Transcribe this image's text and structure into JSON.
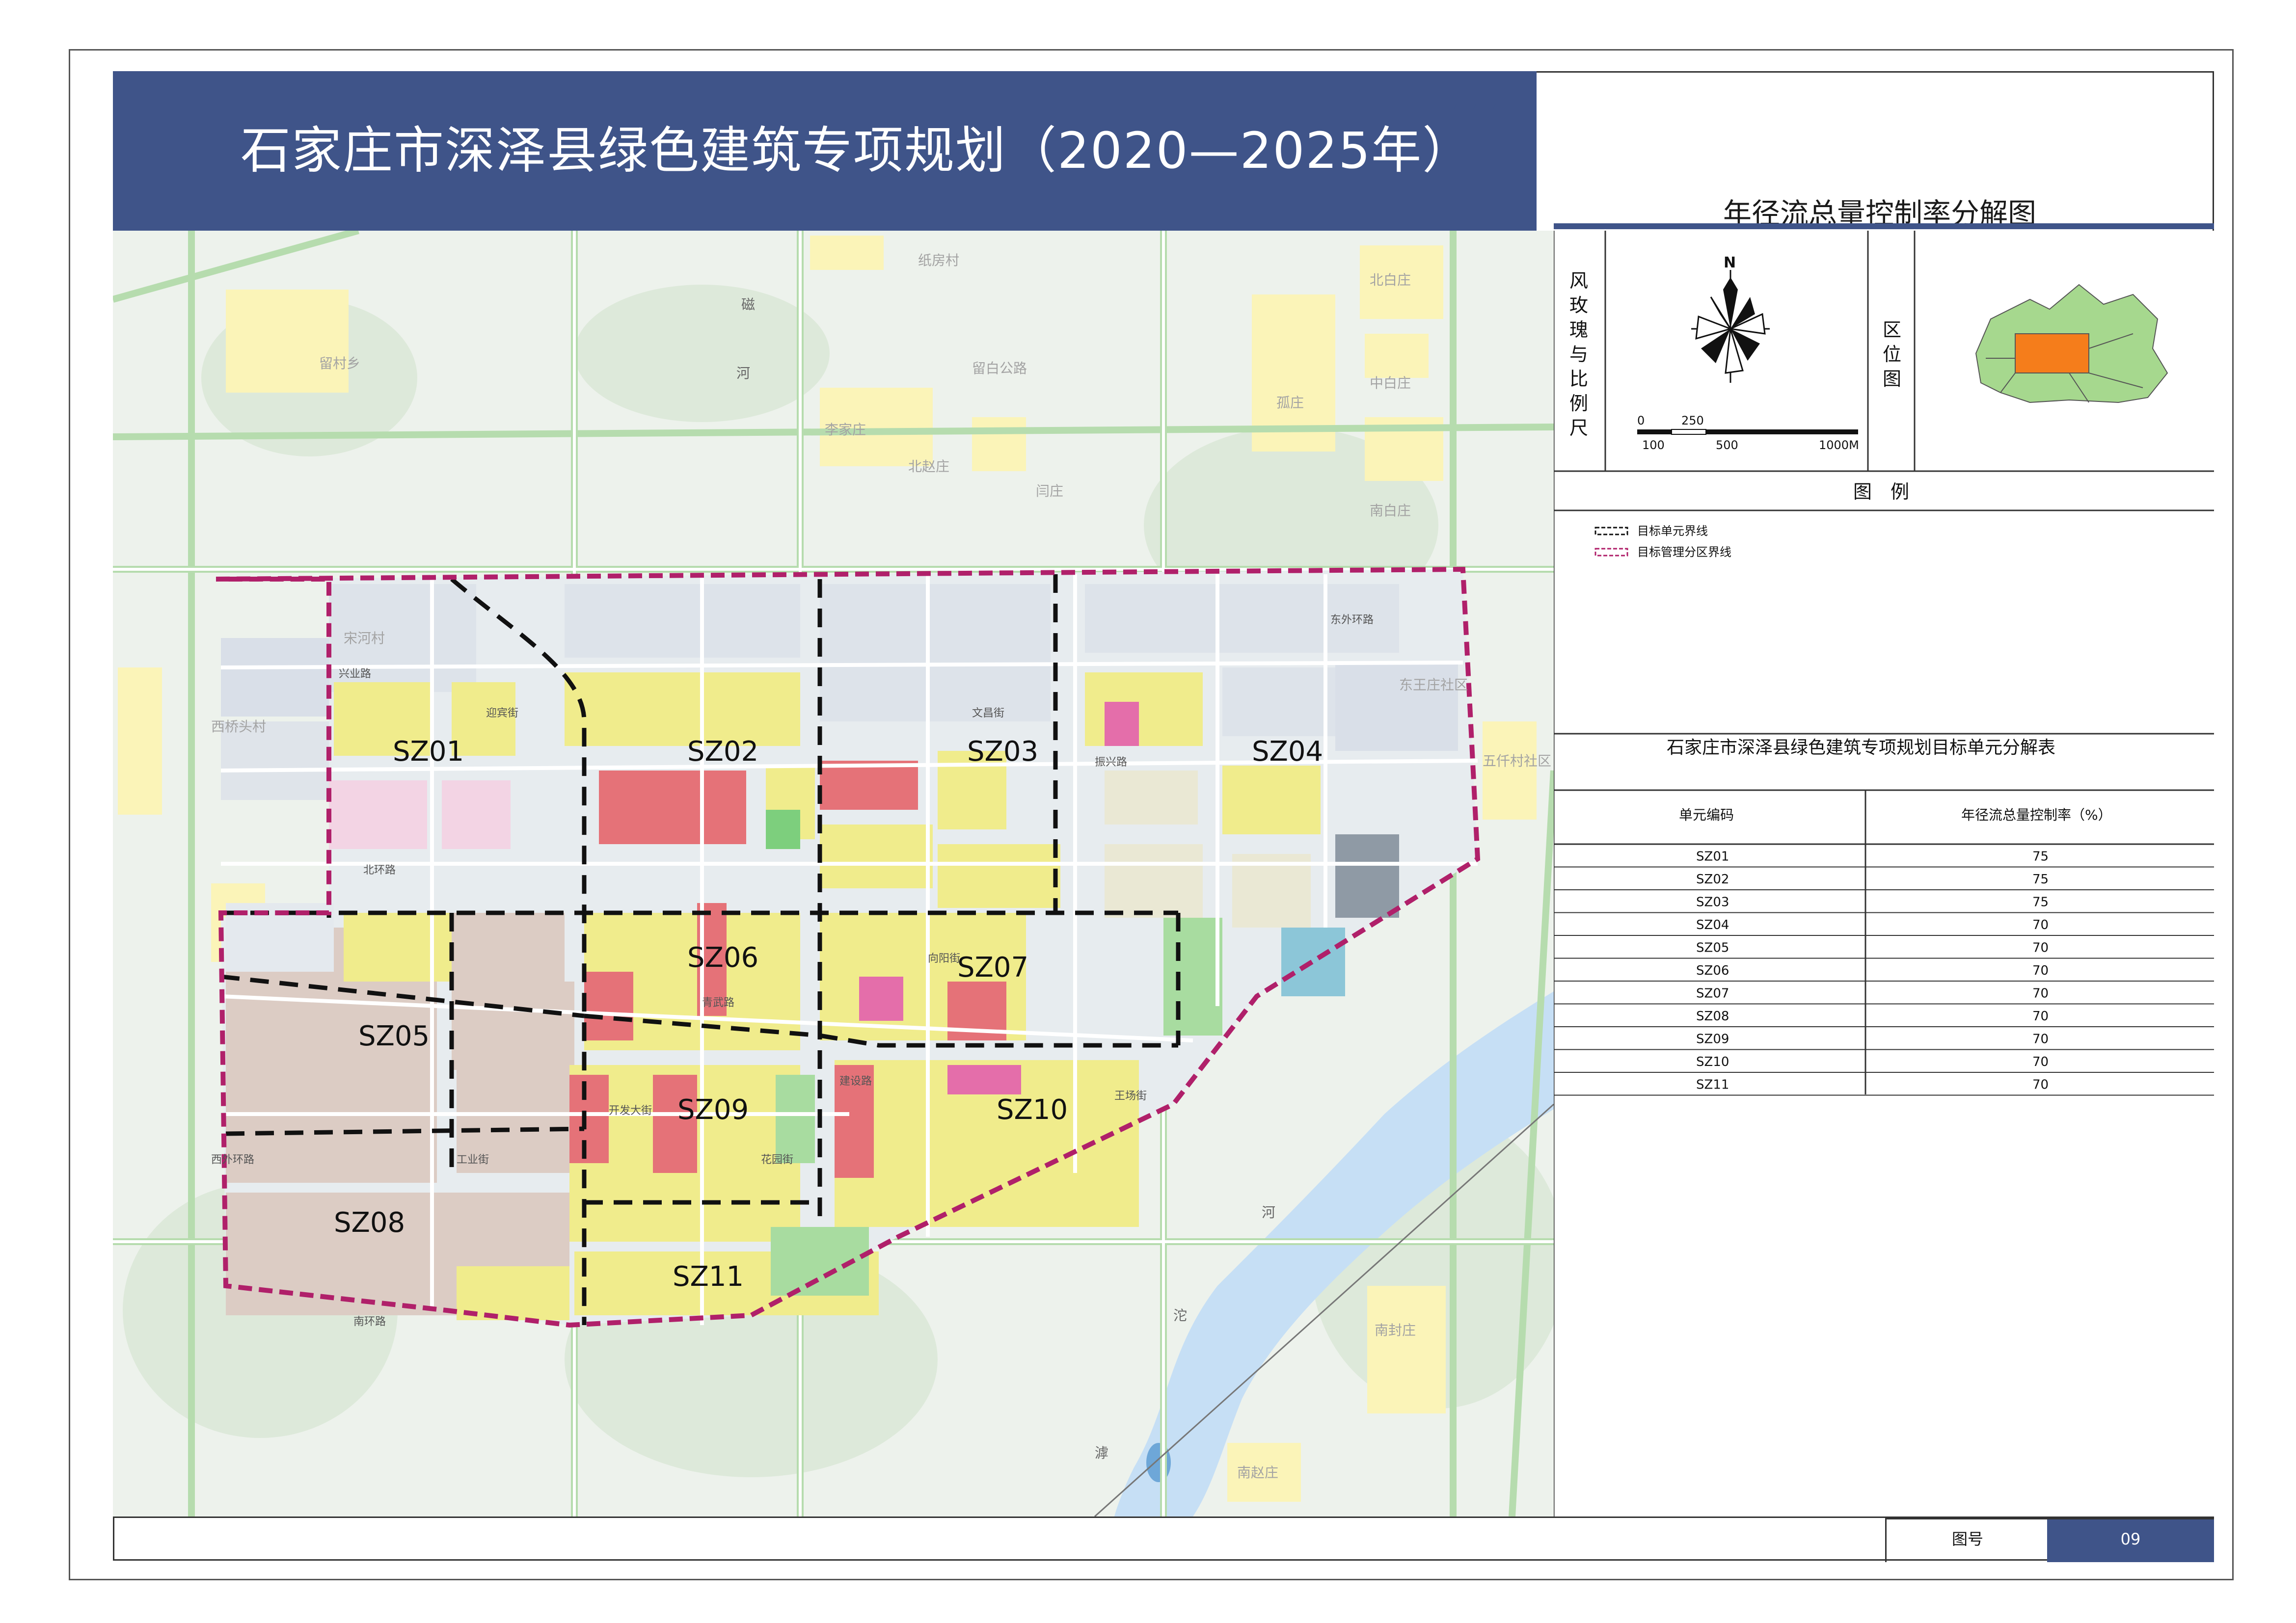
{
  "header": {
    "title": "石家庄市深泽县绿色建筑专项规划（2020—2025年）",
    "map_title": "年径流总量控制率分解图"
  },
  "panel": {
    "rose_label_chars": [
      "风",
      "玫",
      "瑰",
      "与",
      "比",
      "例",
      "尺"
    ],
    "north_label": "N",
    "scale_ticks_top": [
      "0",
      "250"
    ],
    "scale_ticks_bottom": [
      "100",
      "500",
      "1000M"
    ],
    "location_label_chars": [
      "区",
      "位",
      "图"
    ],
    "legend_title": "图　例",
    "legend_items": [
      {
        "label": "目标单元界线",
        "style": "black-dashed"
      },
      {
        "label": "目标管理分区界线",
        "style": "magenta-dashed"
      }
    ],
    "table_title": "石家庄市深泽县绿色建筑专项规划目标单元分解表",
    "table_headers": [
      "单元编码",
      "年径流总量控制率（%）"
    ],
    "table_rows": [
      [
        "SZ01",
        "75"
      ],
      [
        "SZ02",
        "75"
      ],
      [
        "SZ03",
        "75"
      ],
      [
        "SZ04",
        "70"
      ],
      [
        "SZ05",
        "70"
      ],
      [
        "SZ06",
        "70"
      ],
      [
        "SZ07",
        "70"
      ],
      [
        "SZ08",
        "70"
      ],
      [
        "SZ09",
        "70"
      ],
      [
        "SZ10",
        "70"
      ],
      [
        "SZ11",
        "70"
      ]
    ]
  },
  "footer": {
    "figure_label": "图号",
    "figure_number": "09"
  },
  "map": {
    "unit_labels": [
      "SZ01",
      "SZ02",
      "SZ03",
      "SZ04",
      "SZ05",
      "SZ06",
      "SZ07",
      "SZ08",
      "SZ09",
      "SZ10",
      "SZ11"
    ],
    "places": [
      "纸房村",
      "北白庄",
      "留村乡",
      "留白公路",
      "中白庄",
      "李家庄",
      "孤庄",
      "北赵庄",
      "闫庄",
      "南白庄",
      "宋河村",
      "东王庄社区",
      "西桥头村",
      "五仟村社区",
      "南封庄",
      "南赵庄"
    ],
    "roads": [
      "兴业路",
      "北环路",
      "东外环路",
      "南环路",
      "西外环路",
      "迎宾街",
      "开发大街",
      "文昌街",
      "振兴路",
      "青武路",
      "建设路",
      "工业街",
      "花园街",
      "向阳街",
      "王场街"
    ],
    "river_chars": [
      "磁",
      "河",
      "沱",
      "河",
      "滹"
    ],
    "colors": {
      "header_band": "#3f5489",
      "unit_boundary": "#111111",
      "district_boundary": "#b0206a",
      "residential": "#f2f08a",
      "commercial": "#e8707a",
      "industrial": "#d8c8c0",
      "farmland": "#eef3ea",
      "green": "#a8dca0",
      "water": "#c6dff5",
      "road": "#ffffff",
      "village": "#fbf4b8",
      "locator_region": "#a6d88e",
      "locator_highlight": "#f57d1b"
    }
  }
}
